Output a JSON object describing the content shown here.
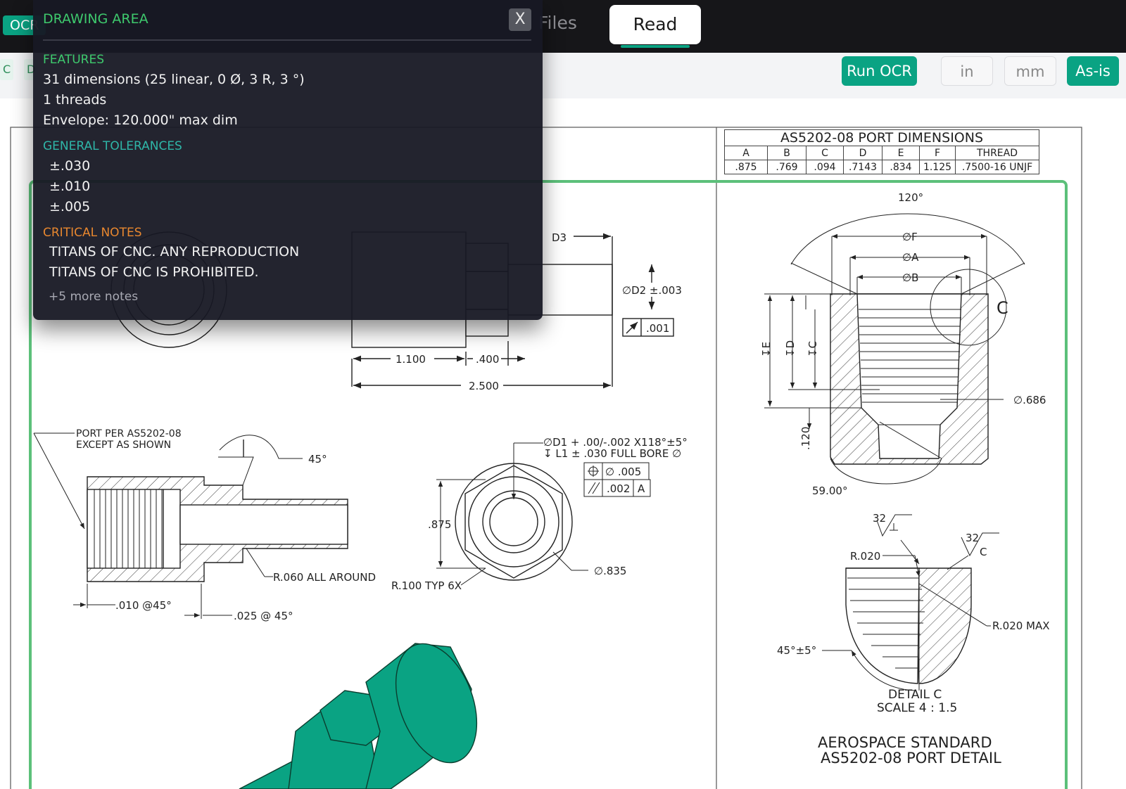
{
  "topbar": {
    "ocr_badge": "OCR",
    "tab_files": "Files",
    "tab_read": "Read"
  },
  "toolbar": {
    "chip_left_1": "C",
    "chip_left_2": "D",
    "run_ocr": "Run OCR",
    "unit_in": "in",
    "unit_mm": "mm",
    "unit_asis": "As-is"
  },
  "overlay": {
    "title": "DRAWING AREA",
    "close_label": "X",
    "features_heading": "FEATURES",
    "features": [
      "31 dimensions  (25 linear, 0 Ø, 3 R, 3 °)",
      "1 threads",
      "Envelope: 120.000\" max dim"
    ],
    "tolerances_heading": "GENERAL TOLERANCES",
    "tolerances": [
      "±.030",
      "±.010",
      "±.005"
    ],
    "notes_heading": "CRITICAL NOTES",
    "notes": [
      "TITANS OF CNC. ANY REPRODUCTION",
      "TITANS OF CNC IS PROHIBITED."
    ],
    "more_notes": "+5 more notes"
  },
  "port_table": {
    "title": "AS5202-08 PORT DIMENSIONS",
    "headers": [
      "A",
      "B",
      "C",
      "D",
      "E",
      "F",
      "THREAD"
    ],
    "values": [
      ".875",
      ".769",
      ".094",
      ".7143",
      ".834",
      "1.125",
      ".7500-16 UNJF"
    ]
  },
  "drawing": {
    "side_view": {
      "d3": "D3",
      "d2": "∅D2 ±.003",
      "runout": ".001",
      "dim_1100": "1.100",
      "dim_400": ".400",
      "dim_2500": "2.500"
    },
    "section_view": {
      "port_note_1": "PORT PER AS5202-08",
      "port_note_2": "EXCEPT AS SHOWN",
      "angle_45": "45°",
      "r060": "R.060 ALL AROUND",
      "chamfer_010": ".010 @45°",
      "chamfer_025": ".025 @ 45°"
    },
    "end_view": {
      "bore_1": "∅D1 + .00/-.002 X118°±5°",
      "bore_2": "↧ L1 ± .030 FULL BORE ∅",
      "pos_tol": "∅ .005",
      "par_tol": ".002",
      "datum_a": "A",
      "dim_875": ".875",
      "r100": "R.100 TYP 6X",
      "dia_835": "∅.835"
    },
    "port_detail": {
      "angle_120": "120°",
      "dia_f": "∅F",
      "dia_a": "∅A",
      "dia_b": "∅B",
      "callout_c": "C",
      "depth_e": "↧E",
      "depth_d": "↧D",
      "depth_c": "↧C",
      "dia_686": "∅.686",
      "dim_120": ".120",
      "angle_59": "59.00°"
    },
    "detail_c": {
      "finish_1": "32",
      "finish_2": "32",
      "finish_2_sym": "C",
      "r020": "R.020",
      "r020max": "R.020 MAX",
      "angle": "45°±5°",
      "label": "DETAIL C",
      "scale": "SCALE 4 : 1.5"
    },
    "title_1": "AEROSPACE STANDARD",
    "title_2": "AS5202-08 PORT DETAIL"
  }
}
